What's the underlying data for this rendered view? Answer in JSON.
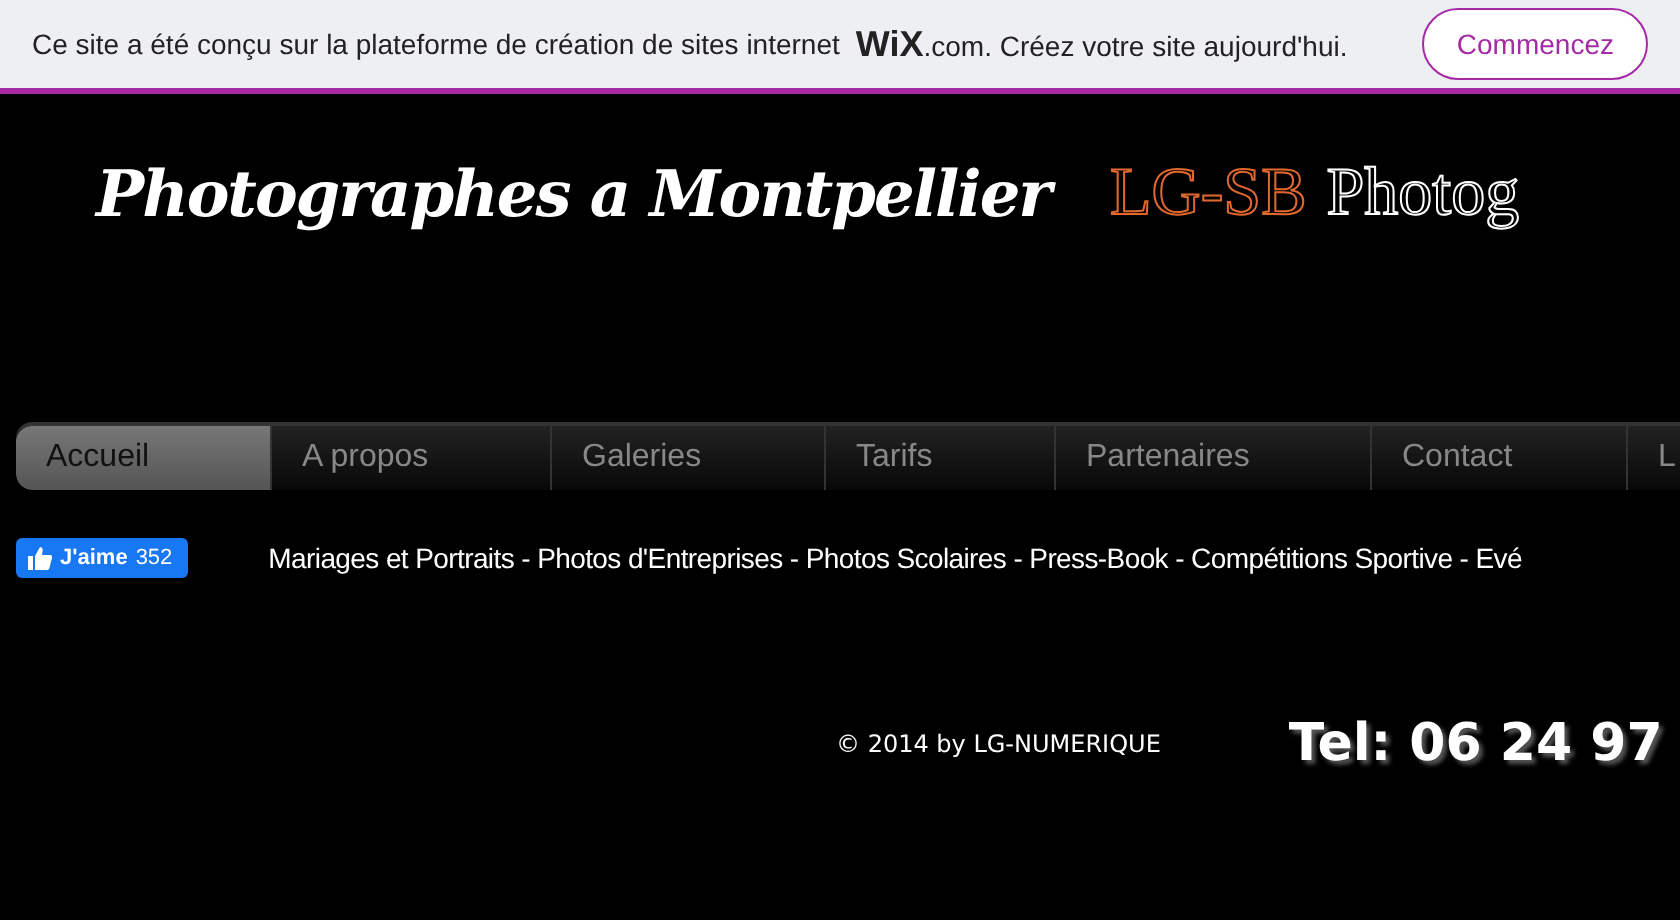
{
  "banner": {
    "text_before": "Ce site a été conçu sur la plateforme de création de sites internet",
    "brand": "WiX",
    "brand_suffix": ".com. Créez votre site aujourd'hui.",
    "button": "Commencez"
  },
  "header": {
    "title": "Photographes a Montpellier",
    "brand": "LG-SB",
    "brand_rest": "Photog"
  },
  "nav": [
    {
      "label": "Accueil",
      "selected": true
    },
    {
      "label": "A propos",
      "selected": false
    },
    {
      "label": "Galeries",
      "selected": false
    },
    {
      "label": "Tarifs",
      "selected": false
    },
    {
      "label": "Partenaires",
      "selected": false
    },
    {
      "label": "Contact",
      "selected": false
    },
    {
      "label": "L",
      "selected": false
    }
  ],
  "like_button": {
    "label": "J'aime",
    "count": "352"
  },
  "tagline": "Mariages et Portraits - Photos d'Entreprises - Photos Scolaires - Press-Book - Compétitions Sportive - Evé",
  "footer": {
    "copyright": "© 2014 by LG-NUMERIQUE",
    "phone": "Tel: 06 24 97"
  }
}
